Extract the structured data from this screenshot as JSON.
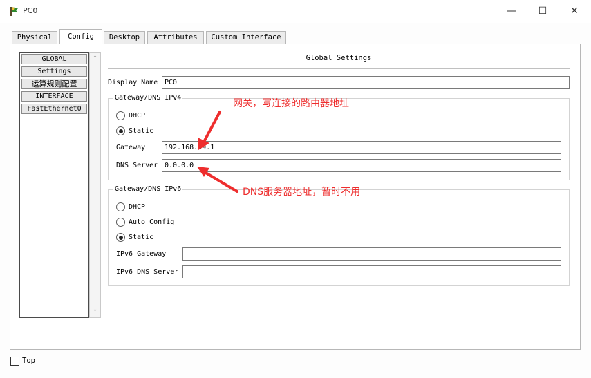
{
  "window": {
    "title": "PC0",
    "controls": {
      "minimize": "—",
      "maximize": "☐",
      "close": "✕"
    }
  },
  "tabs": [
    {
      "label": "Physical"
    },
    {
      "label": "Config"
    },
    {
      "label": "Desktop"
    },
    {
      "label": "Attributes"
    },
    {
      "label": "Custom Interface"
    }
  ],
  "active_tab": "Config",
  "sidebar": {
    "items": [
      "GLOBAL",
      "Settings",
      "运算规则配置",
      "INTERFACE",
      "FastEthernet0"
    ]
  },
  "global_settings": {
    "title": "Global Settings",
    "display_name_label": "Display Name",
    "display_name_value": "PC0",
    "ipv4": {
      "title": "Gateway/DNS IPv4",
      "dhcp_label": "DHCP",
      "static_label": "Static",
      "selected": "Static",
      "gateway_label": "Gateway",
      "gateway_value": "192.168.99.1",
      "dns_label": "DNS Server",
      "dns_value": "0.0.0.0"
    },
    "ipv6": {
      "title": "Gateway/DNS IPv6",
      "dhcp_label": "DHCP",
      "auto_label": "Auto Config",
      "static_label": "Static",
      "selected": "Static",
      "gateway_label": "IPv6 Gateway",
      "gateway_value": "",
      "dns_label": "IPv6 DNS Server",
      "dns_value": ""
    }
  },
  "annotations": {
    "gateway_note": "网关，写连接的路由器地址",
    "dns_note": "DNS服务器地址，暂时不用",
    "color": "#ee2d2d"
  },
  "footer": {
    "top_label": "Top",
    "top_checked": false
  }
}
